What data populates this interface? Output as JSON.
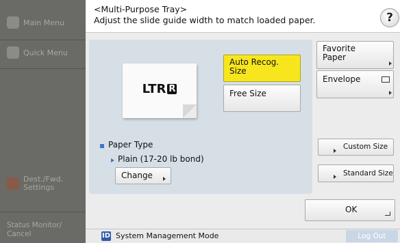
{
  "sidebar": {
    "main_menu": "Main Menu",
    "quick_menu": "Quick Menu",
    "dest_fwd": "Dest./Fwd. Settings",
    "dest_line1": "Dest./Fwd.",
    "dest_line2": "Settings",
    "status_line1": "Status Monitor/",
    "status_line2": "Cancel"
  },
  "header": {
    "title": "<Multi-Purpose Tray>",
    "subtitle": "Adjust the slide guide width to match loaded paper.",
    "help": "?"
  },
  "paper": {
    "size": "LTR",
    "orientation_mark": "R"
  },
  "size_options": {
    "auto_recog_line1": "Auto Recog.",
    "auto_recog_line2": "Size",
    "free_size": "Free Size"
  },
  "right_buttons": {
    "favorite_line1": "Favorite",
    "favorite_line2": "Paper",
    "envelope": "Envelope",
    "custom_size": "Custom Size",
    "standard_size": "Standard Size"
  },
  "paper_type": {
    "label": "Paper Type",
    "value": "Plain (17-20 lb bond)",
    "change": "Change"
  },
  "actions": {
    "ok": "OK"
  },
  "footer": {
    "badge": "ID",
    "mode": "System Management Mode",
    "logout": "Log Out"
  },
  "colors": {
    "selected": "#f7e61e",
    "panel": "#d6dee6",
    "sidebar": "#6a6a66",
    "accent_blue": "#3c78c8"
  }
}
